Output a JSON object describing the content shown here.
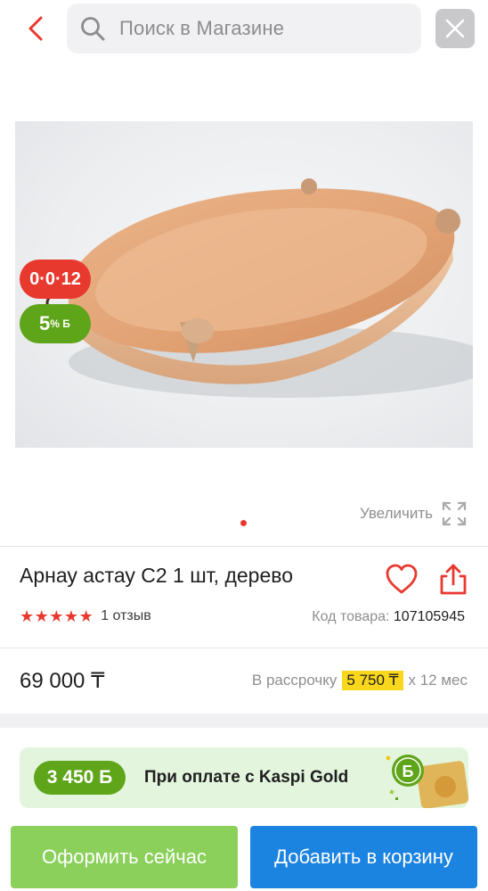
{
  "header": {
    "search_placeholder": "Поиск в Магазине",
    "icons": [
      "chevron-left-icon",
      "search-icon",
      "close-icon"
    ],
    "accent_color": "#e8392f"
  },
  "gallery": {
    "badges": {
      "installment_label": "0·0·12",
      "bonus_percent": "5",
      "bonus_suffix": "% Б"
    },
    "zoom_label": "Увеличить",
    "slide_count": 1,
    "active_slide": 1
  },
  "product": {
    "title": "Арнау астау С2 1 шт, дерево",
    "rating_stars": 5,
    "reviews_label": "1 отзыв",
    "code_label": "Код товара:",
    "code_value": "107105945",
    "price": "69 000 ₸",
    "installment_prefix": "В рассрочку",
    "installment_amount": "5 750 ₸",
    "installment_suffix": "х 12 мес"
  },
  "promo": {
    "bonus_amount": "3 450 Б",
    "text": "При оплате с Kaspi Gold",
    "color": "#5fa51a"
  },
  "actions": {
    "buy_now_label": "Оформить сейчас",
    "add_to_cart_label": "Добавить в корзину",
    "buy_color": "#8ad05a",
    "cart_color": "#1b83e0"
  }
}
